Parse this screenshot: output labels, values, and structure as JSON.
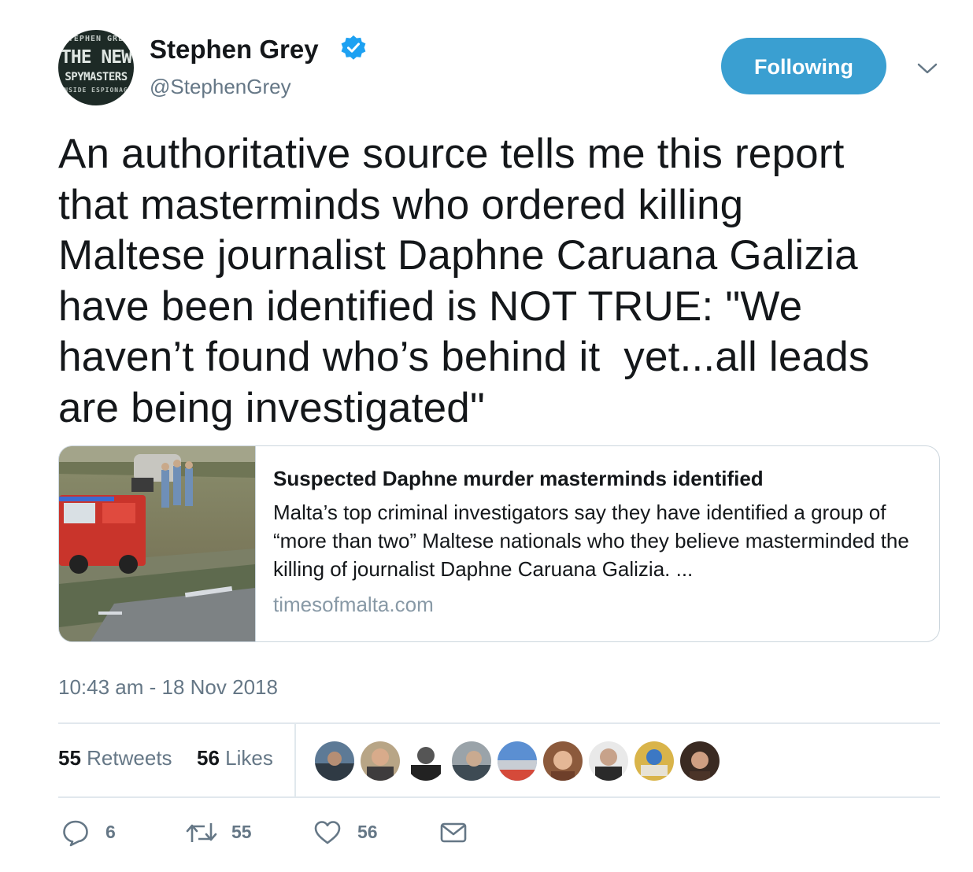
{
  "author": {
    "avatar_lines": [
      "STEPHEN GREY",
      "THE NEW",
      "SPYMASTERS",
      "INSIDE ESPIONAGE"
    ],
    "name": "Stephen Grey",
    "handle": "@StephenGrey",
    "verified": true
  },
  "follow_button": {
    "label": "Following",
    "color": "#3a9fd1"
  },
  "menu_icon": "chevron-down-icon",
  "tweet": {
    "text": "An authoritative source tells me this report\nthat masterminds who ordered killing\nMaltese journalist Daphne Caruana Galizia\nhave been identified is NOT TRUE: \"We\nhaven’t found who’s behind it  yet...all leads\nare being investigated\""
  },
  "card": {
    "title": "Suspected Daphne murder masterminds identified",
    "description": "Malta’s top criminal investigators say they have identified a group of “more than two” Maltese nationals who they believe masterminded the killing of journalist Daphne Caruana Galizia. ...",
    "domain": "timesofmalta.com"
  },
  "timestamp": "10:43 am - 18 Nov 2018",
  "stats": {
    "retweets_count": "55",
    "retweets_label": "Retweets",
    "likes_count": "56",
    "likes_label": "Likes"
  },
  "actions": {
    "reply_count": "6",
    "retweet_count": "55",
    "like_count": "56"
  },
  "colors": {
    "accent": "#3a9fd1",
    "verified": "#1da1f2",
    "secondary_text": "#657786",
    "divider": "#e1e8ed"
  }
}
